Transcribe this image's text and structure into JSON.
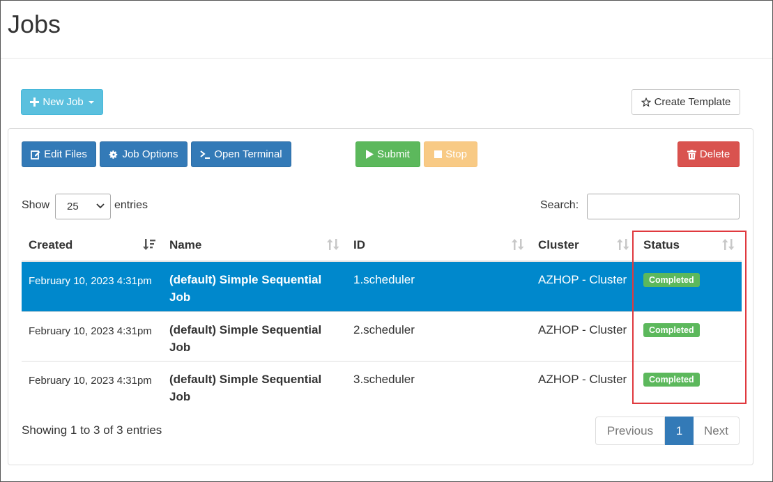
{
  "page": {
    "title": "Jobs"
  },
  "toolbar_top": {
    "new_job_label": "New Job",
    "create_template_label": "Create Template"
  },
  "toolbar": {
    "edit_files_label": "Edit Files",
    "job_options_label": "Job Options",
    "open_terminal_label": "Open Terminal",
    "submit_label": "Submit",
    "stop_label": "Stop",
    "delete_label": "Delete"
  },
  "table_controls": {
    "show_label": "Show",
    "entries_value": "25",
    "entries_label": "entries",
    "search_label": "Search:",
    "search_value": ""
  },
  "table": {
    "columns": [
      "Created",
      "Name",
      "ID",
      "Cluster",
      "Status"
    ],
    "rows": [
      {
        "created": "February 10, 2023 4:31pm",
        "name": "(default) Simple Sequential Job",
        "id": "1.scheduler",
        "cluster": "AZHOP - Cluster",
        "status": "Completed",
        "selected": true
      },
      {
        "created": "February 10, 2023 4:31pm",
        "name": "(default) Simple Sequential Job",
        "id": "2.scheduler",
        "cluster": "AZHOP - Cluster",
        "status": "Completed",
        "selected": false
      },
      {
        "created": "February 10, 2023 4:31pm",
        "name": "(default) Simple Sequential Job",
        "id": "3.scheduler",
        "cluster": "AZHOP - Cluster",
        "status": "Completed",
        "selected": false
      }
    ]
  },
  "footer": {
    "info": "Showing 1 to 3 of 3 entries",
    "previous_label": "Previous",
    "current_page": "1",
    "next_label": "Next"
  },
  "colors": {
    "selected_row": "#0088cc",
    "badge_success": "#5cb85c",
    "highlight": "#e0393e"
  }
}
